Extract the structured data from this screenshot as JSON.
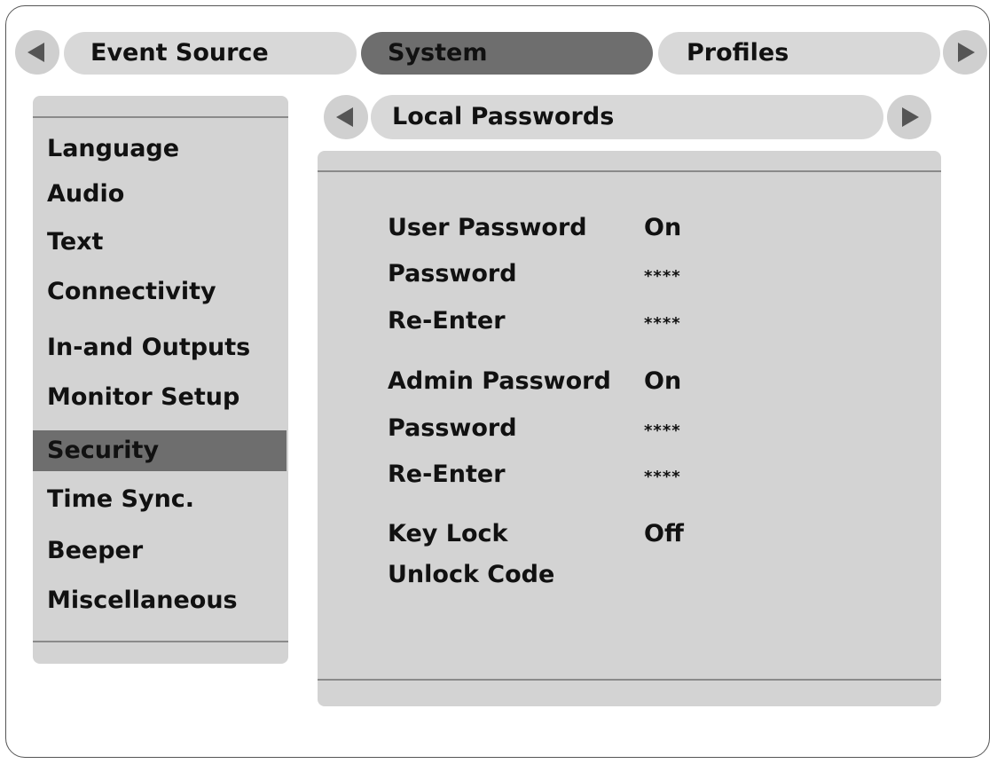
{
  "top_tabs": [
    {
      "label": "Event Source",
      "active": false
    },
    {
      "label": "System",
      "active": true
    },
    {
      "label": "Profiles",
      "active": false
    }
  ],
  "sidebar": {
    "items": [
      {
        "label": "Language",
        "active": false
      },
      {
        "label": "Audio",
        "active": false
      },
      {
        "label": "Text",
        "active": false
      },
      {
        "label": "Connectivity",
        "active": false
      },
      {
        "label": "In-and Outputs",
        "active": false
      },
      {
        "label": "Monitor Setup",
        "active": false
      },
      {
        "label": "Security",
        "active": true
      },
      {
        "label": "Time Sync.",
        "active": false
      },
      {
        "label": "Beeper",
        "active": false
      },
      {
        "label": "Miscellaneous",
        "active": false
      }
    ]
  },
  "sub_header": {
    "title": "Local Passwords"
  },
  "settings": [
    {
      "label": "User Password",
      "value": "On"
    },
    {
      "label": "Password",
      "value": "****"
    },
    {
      "label": "Re-Enter",
      "value": "****"
    },
    {
      "label": "Admin Password",
      "value": "On"
    },
    {
      "label": "Password",
      "value": "****"
    },
    {
      "label": "Re-Enter",
      "value": "****"
    },
    {
      "label": "Key Lock",
      "value": "Off"
    },
    {
      "label": "Unlock Code",
      "value": ""
    }
  ],
  "colors": {
    "panel": "#d3d3d3",
    "tab": "#d8d8d8",
    "active": "#6e6e6e",
    "arrow": "#555555"
  },
  "icons": {
    "top_left_arrow": "triangle-left-icon",
    "top_right_arrow": "triangle-right-icon",
    "sub_left_arrow": "triangle-left-icon",
    "sub_right_arrow": "triangle-right-icon"
  }
}
